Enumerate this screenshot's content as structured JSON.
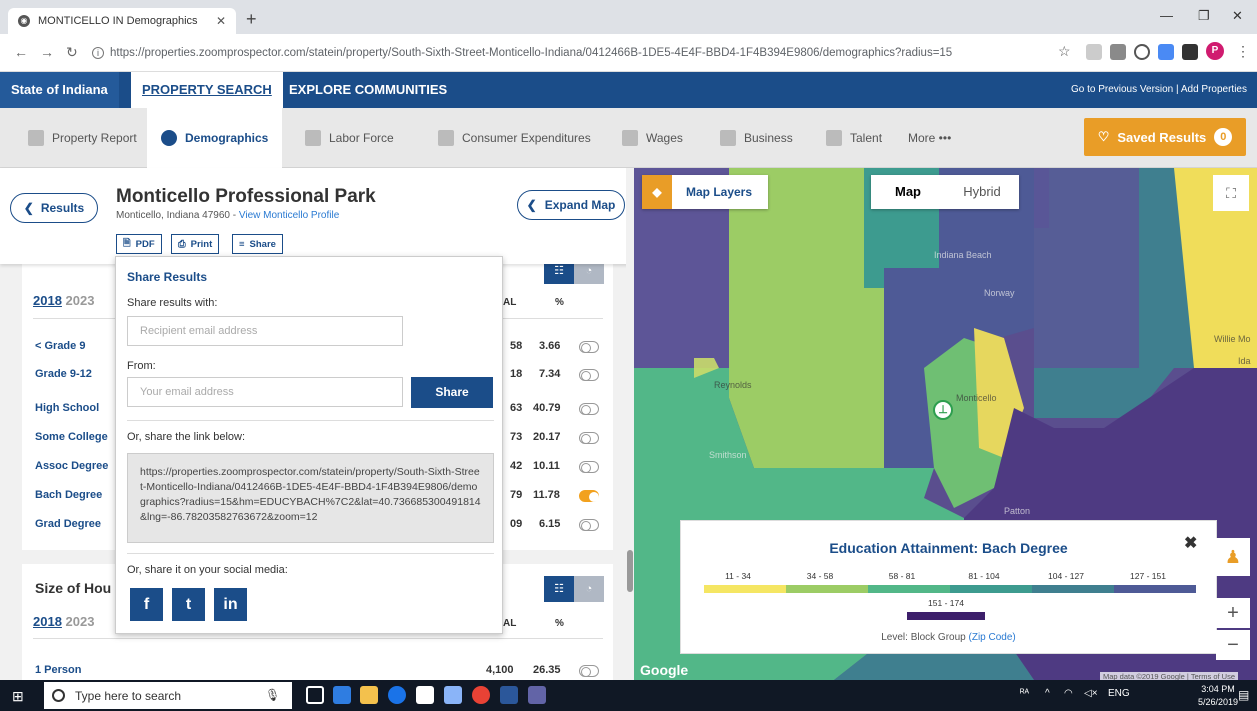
{
  "browser": {
    "tab_title": "MONTICELLO IN Demographics",
    "url": "https://properties.zoomprospector.com/statein/property/South-Sixth-Street-Monticello-Indiana/0412466B-1DE5-4E4F-BBD4-1F4B394E9806/demographics?radius=15",
    "profile_initial": "P"
  },
  "sitenav": {
    "state": "State of Indiana",
    "property_search": "PROPERTY SEARCH",
    "explore": "EXPLORE COMMUNITIES",
    "toplinks": "Go to Previous Version  |  Add Properties"
  },
  "tabs": [
    {
      "label": "Property Report"
    },
    {
      "label": "Demographics"
    },
    {
      "label": "Labor Force"
    },
    {
      "label": "Consumer Expenditures"
    },
    {
      "label": "Wages"
    },
    {
      "label": "Business"
    },
    {
      "label": "Talent"
    },
    {
      "label": "More •••"
    }
  ],
  "saved": {
    "label": "Saved Results",
    "count": "0"
  },
  "header": {
    "results_btn": "Results",
    "title": "Monticello Professional Park",
    "subtitle": "Monticello, Indiana 47960 - ",
    "profile_link": "View Monticello Profile",
    "expand_btn": "Expand Map",
    "pdf": "PDF",
    "print": "Print",
    "share": "Share"
  },
  "education": {
    "years": [
      "2018",
      "2023"
    ],
    "col_total_tail": "AL",
    "col_pct": "%",
    "rows": [
      {
        "label": "< Grade 9",
        "tail": "58",
        "pct": "3.66",
        "on": false
      },
      {
        "label": "Grade 9-12",
        "tail": "18",
        "pct": "7.34",
        "on": false
      },
      {
        "label": "High School",
        "tail": "63",
        "pct": "40.79",
        "on": false
      },
      {
        "label": "Some College",
        "tail": "73",
        "pct": "20.17",
        "on": false
      },
      {
        "label": "Assoc Degree",
        "tail": "42",
        "pct": "10.11",
        "on": false
      },
      {
        "label": "Bach Degree",
        "tail": "79",
        "pct": "11.78",
        "on": true
      },
      {
        "label": "Grad Degree",
        "tail": "09",
        "pct": "6.15",
        "on": false
      }
    ]
  },
  "household": {
    "title_visible": "Size of Hou",
    "years": [
      "2018",
      "2023"
    ],
    "col_total_tail": "AL",
    "col_pct": "%",
    "row1": {
      "label": "1 Person",
      "total": "4,100",
      "pct": "26.35"
    }
  },
  "share": {
    "title": "Share Results",
    "with_label": "Share results with:",
    "recipient_placeholder": "Recipient email address",
    "from_label": "From:",
    "email_placeholder": "Your email address",
    "share_btn": "Share",
    "link_label": "Or, share the link below:",
    "link": "https://properties.zoomprospector.com/statein/property/South-Sixth-Street-Monticello-Indiana/0412466B-1DE5-4E4F-BBD4-1F4B394E9806/demographics?radius=15&hm=EDUCYBACH%7C2&lat=40.736685300491814&lng=-86.78203582763672&zoom=12",
    "social_label": "Or, share it on your social media:",
    "fb": "f",
    "tw": "t",
    "li": "in"
  },
  "map": {
    "layers_btn": "Map Layers",
    "type_map": "Map",
    "type_hybrid": "Hybrid",
    "places": [
      "Indiana Beach",
      "Norway",
      "Reynolds",
      "Monticello",
      "Smithson",
      "Patton",
      "Willie Mo",
      "Ida"
    ],
    "google": "Google",
    "attribution": "Map data ©2019 Google | Terms of Use"
  },
  "legend": {
    "title": "Education Attainment: Bach Degree",
    "ranges": [
      "11 - 34",
      "34 - 58",
      "58 - 81",
      "81 - 104",
      "104 - 127",
      "127 - 151",
      "151 - 174"
    ],
    "colors": [
      "#f5e663",
      "#9ccc65",
      "#52b788",
      "#3d9b8f",
      "#3f7f8f",
      "#4e5a96",
      "#3d1f6b"
    ],
    "level_text": "Level: Block Group ",
    "level_link": "(Zip Code)"
  },
  "taskbar": {
    "search": "Type here to search",
    "time": "3:04 PM",
    "date": "5/26/2019",
    "lang": "ENG"
  }
}
